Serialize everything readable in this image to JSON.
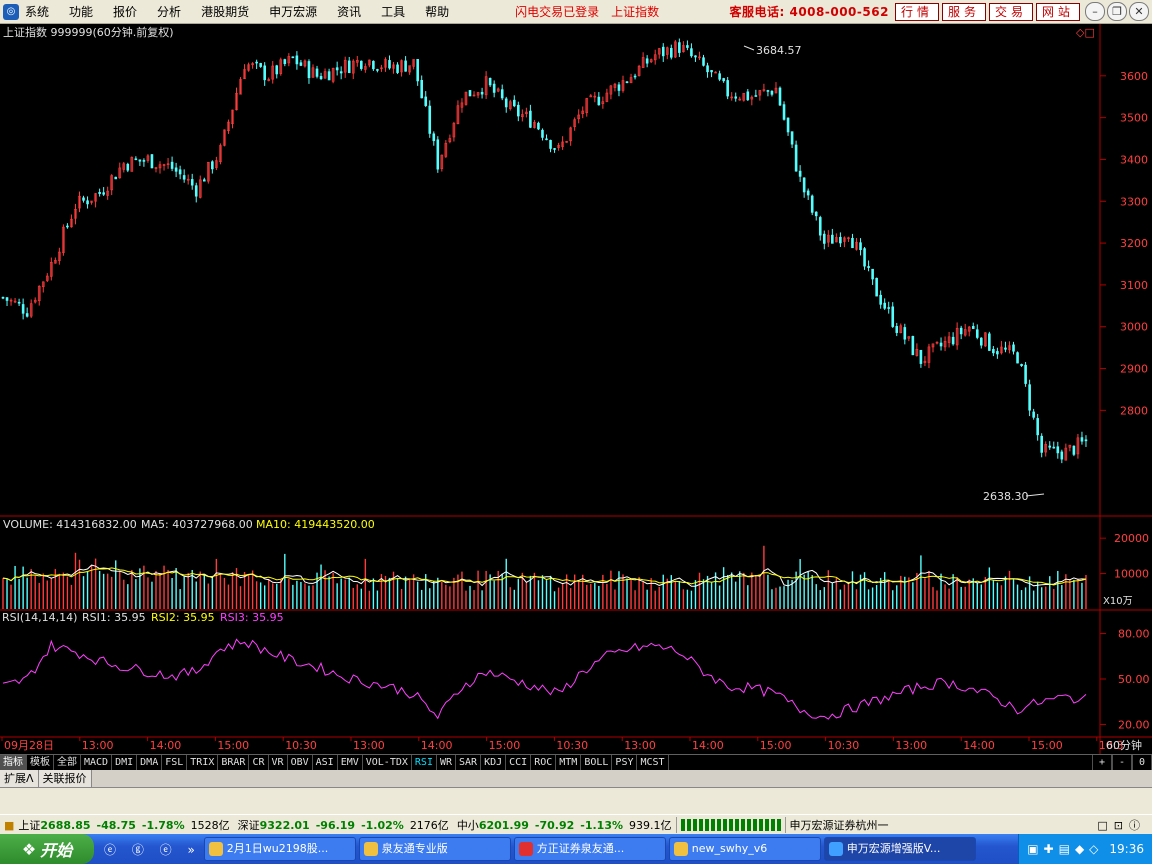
{
  "menubar": {
    "app_icon": "app-logo-icon",
    "items": [
      "系统",
      "功能",
      "报价",
      "分析",
      "港股期货",
      "申万宏源",
      "资讯",
      "工具",
      "帮助"
    ],
    "status_login": "闪电交易已登录",
    "status_index": "上证指数",
    "hotline": "客服电话: 4008-000-562",
    "buttons": [
      "行情",
      "服务",
      "交易",
      "网站"
    ]
  },
  "chart": {
    "header": "上证指数 999999(60分钟.前复权)",
    "high_label": "3684.57",
    "low_label": "2638.30",
    "price_ticks": [
      "3600",
      "3500",
      "3400",
      "3300",
      "3200",
      "3100",
      "3000",
      "2900",
      "2800"
    ],
    "volume_header": {
      "volume": "VOLUME: 414316832.00",
      "ma5": "MA5: 403727968.00",
      "ma10": "MA10: 419443520.00"
    },
    "volume_ticks": [
      "20000",
      "10000"
    ],
    "volume_unit": "X10万",
    "rsi_header": {
      "title": "RSI(14,14,14)",
      "rsi1": "RSI1: 35.95",
      "rsi2": "RSI2: 35.95",
      "rsi3": "RSI3: 35.95"
    },
    "rsi_ticks": [
      "80.00",
      "50.00",
      "20.00"
    ],
    "time_labels": [
      "09月28日",
      "13:00",
      "14:00",
      "15:00",
      "10:30",
      "13:00",
      "14:00",
      "15:00",
      "10:30",
      "13:00",
      "14:00",
      "15:00",
      "10:30",
      "13:00",
      "14:00",
      "15:00",
      "10:3"
    ],
    "period_label": "60分钟",
    "colors": {
      "up": "#ff3c3c",
      "down": "#54ffff",
      "rsi": "#ff40ff",
      "ma5": "#ffffff",
      "ma10": "#ffff00",
      "axis": "#b00000"
    }
  },
  "chart_data": {
    "type": "candlestick",
    "title": "上证指数 999999(60分钟.前复权)",
    "y_range": [
      2600,
      3700
    ],
    "price_high": 3684.57,
    "price_low": 2638.3,
    "close_path_anchors": [
      [
        0,
        3070
      ],
      [
        6,
        3040
      ],
      [
        12,
        3150
      ],
      [
        18,
        3290
      ],
      [
        24,
        3320
      ],
      [
        30,
        3390
      ],
      [
        36,
        3400
      ],
      [
        42,
        3380
      ],
      [
        48,
        3330
      ],
      [
        54,
        3420
      ],
      [
        60,
        3630
      ],
      [
        66,
        3600
      ],
      [
        72,
        3640
      ],
      [
        78,
        3600
      ],
      [
        84,
        3620
      ],
      [
        90,
        3640
      ],
      [
        96,
        3620
      ],
      [
        102,
        3630
      ],
      [
        108,
        3390
      ],
      [
        114,
        3550
      ],
      [
        120,
        3580
      ],
      [
        126,
        3520
      ],
      [
        132,
        3490
      ],
      [
        138,
        3420
      ],
      [
        144,
        3520
      ],
      [
        150,
        3560
      ],
      [
        156,
        3600
      ],
      [
        162,
        3650
      ],
      [
        168,
        3670
      ],
      [
        174,
        3620
      ],
      [
        180,
        3560
      ],
      [
        186,
        3550
      ],
      [
        192,
        3570
      ],
      [
        198,
        3350
      ],
      [
        204,
        3200
      ],
      [
        210,
        3230
      ],
      [
        216,
        3100
      ],
      [
        222,
        3000
      ],
      [
        228,
        2920
      ],
      [
        234,
        2960
      ],
      [
        240,
        3000
      ],
      [
        246,
        2950
      ],
      [
        252,
        2930
      ],
      [
        258,
        2700
      ],
      [
        264,
        2700
      ],
      [
        270,
        2730
      ]
    ],
    "rsi_anchors": [
      [
        0,
        45
      ],
      [
        6,
        50
      ],
      [
        12,
        72
      ],
      [
        18,
        68
      ],
      [
        24,
        62
      ],
      [
        30,
        58
      ],
      [
        36,
        55
      ],
      [
        42,
        52
      ],
      [
        48,
        55
      ],
      [
        54,
        70
      ],
      [
        60,
        75
      ],
      [
        66,
        68
      ],
      [
        72,
        62
      ],
      [
        78,
        58
      ],
      [
        84,
        52
      ],
      [
        90,
        48
      ],
      [
        96,
        45
      ],
      [
        102,
        40
      ],
      [
        108,
        25
      ],
      [
        114,
        45
      ],
      [
        120,
        55
      ],
      [
        126,
        50
      ],
      [
        132,
        45
      ],
      [
        138,
        40
      ],
      [
        144,
        55
      ],
      [
        150,
        65
      ],
      [
        156,
        70
      ],
      [
        162,
        72
      ],
      [
        168,
        68
      ],
      [
        174,
        55
      ],
      [
        180,
        45
      ],
      [
        186,
        44
      ],
      [
        192,
        40
      ],
      [
        198,
        30
      ],
      [
        204,
        25
      ],
      [
        210,
        30
      ],
      [
        216,
        35
      ],
      [
        222,
        40
      ],
      [
        228,
        45
      ],
      [
        234,
        48
      ],
      [
        240,
        44
      ],
      [
        246,
        38
      ],
      [
        252,
        30
      ],
      [
        258,
        35
      ],
      [
        264,
        38
      ],
      [
        270,
        36
      ]
    ],
    "rsi_values": {
      "rsi1": 35.95,
      "rsi2": 35.95,
      "rsi3": 35.95
    },
    "volume_values": {
      "volume": 414316832.0,
      "ma5": 403727968.0,
      "ma10": 419443520.0
    }
  },
  "indicator_tabs": [
    "指标",
    "模板",
    "全部",
    "MACD",
    "DMI",
    "DMA",
    "FSL",
    "TRIX",
    "BRAR",
    "CR",
    "VR",
    "OBV",
    "ASI",
    "EMV",
    "VOL-TDX",
    "RSI",
    "WR",
    "SAR",
    "KDJ",
    "CCI",
    "ROC",
    "MTM",
    "BOLL",
    "PSY",
    "MCST"
  ],
  "indicator_right": [
    "+",
    "-",
    "0"
  ],
  "sub_tabs": [
    "扩展Λ",
    "关联报价"
  ],
  "ticker": {
    "sh_label": "上证",
    "sh_value": "2688.85",
    "sh_change": "-48.75",
    "sh_pct": "-1.78%",
    "sh_amount": "1528亿",
    "sz_label": "深证",
    "sz_value": "9322.01",
    "sz_change": "-96.19",
    "sz_pct": "-1.02%",
    "sz_amount": "2176亿",
    "zx_label": "中小",
    "zx_value": "6201.99",
    "zx_change": "-70.92",
    "zx_pct": "-1.13%",
    "zx_amount": "939.1亿",
    "broker": "申万宏源证券杭州一"
  },
  "taskbar": {
    "start": "开始",
    "apps": [
      "2月1日wu2198股...",
      "泉友通专业版",
      "方正证券泉友通...",
      "new_swhy_v6",
      "申万宏源增强版V..."
    ],
    "clock": "19:36"
  }
}
